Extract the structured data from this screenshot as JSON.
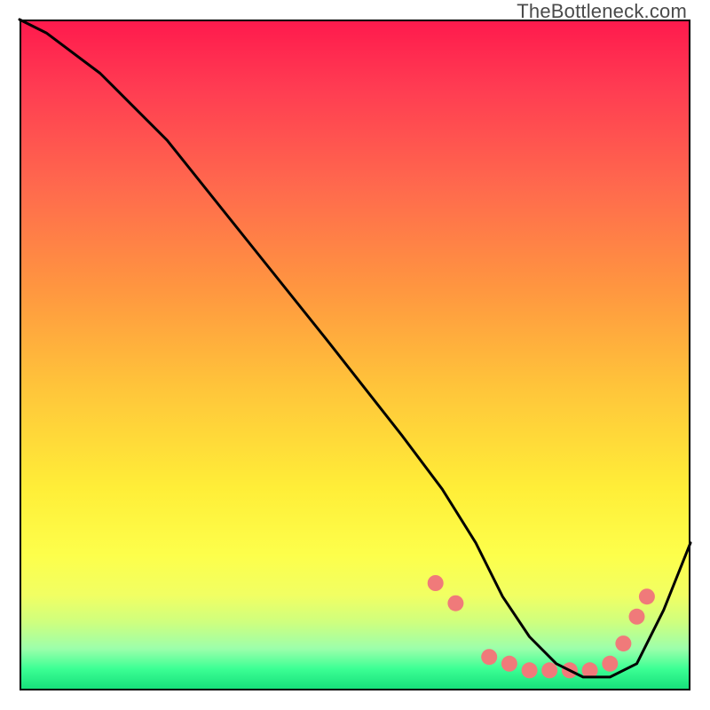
{
  "watermark": "TheBottleneck.com",
  "chart_data": {
    "type": "line",
    "title": "",
    "xlabel": "",
    "ylabel": "",
    "xlim": [
      0,
      100
    ],
    "ylim": [
      0,
      100
    ],
    "grid": false,
    "note": "No axis ticks or labels are rendered; values are normalized 0–100 estimated from pixel position.",
    "background_gradient": {
      "orientation": "vertical",
      "stops": [
        {
          "pos": 0,
          "color": "#ff1a4d"
        },
        {
          "pos": 25,
          "color": "#ff6a4d"
        },
        {
          "pos": 55,
          "color": "#ffc53a"
        },
        {
          "pos": 80,
          "color": "#fdff4b"
        },
        {
          "pos": 94,
          "color": "#9cffab"
        },
        {
          "pos": 100,
          "color": "#17e07b"
        }
      ]
    },
    "series": [
      {
        "name": "bottleneck-curve",
        "color": "#000000",
        "stroke_width": 3,
        "x": [
          0,
          4,
          12,
          22,
          34,
          46,
          57,
          63,
          68,
          72,
          76,
          80,
          84,
          88,
          92,
          96,
          100
        ],
        "y": [
          100,
          98,
          92,
          82,
          67,
          52,
          38,
          30,
          22,
          14,
          8,
          4,
          2,
          2,
          4,
          12,
          22
        ]
      }
    ],
    "markers": {
      "name": "optimal-range-dots",
      "color": "#f07a7a",
      "radius": 9,
      "points": [
        {
          "x": 62,
          "y": 16
        },
        {
          "x": 65,
          "y": 13
        },
        {
          "x": 70,
          "y": 5
        },
        {
          "x": 73,
          "y": 4
        },
        {
          "x": 76,
          "y": 3
        },
        {
          "x": 79,
          "y": 3
        },
        {
          "x": 82,
          "y": 3
        },
        {
          "x": 85,
          "y": 3
        },
        {
          "x": 88,
          "y": 4
        },
        {
          "x": 90,
          "y": 7
        },
        {
          "x": 92,
          "y": 11
        },
        {
          "x": 93.5,
          "y": 14
        }
      ]
    }
  }
}
